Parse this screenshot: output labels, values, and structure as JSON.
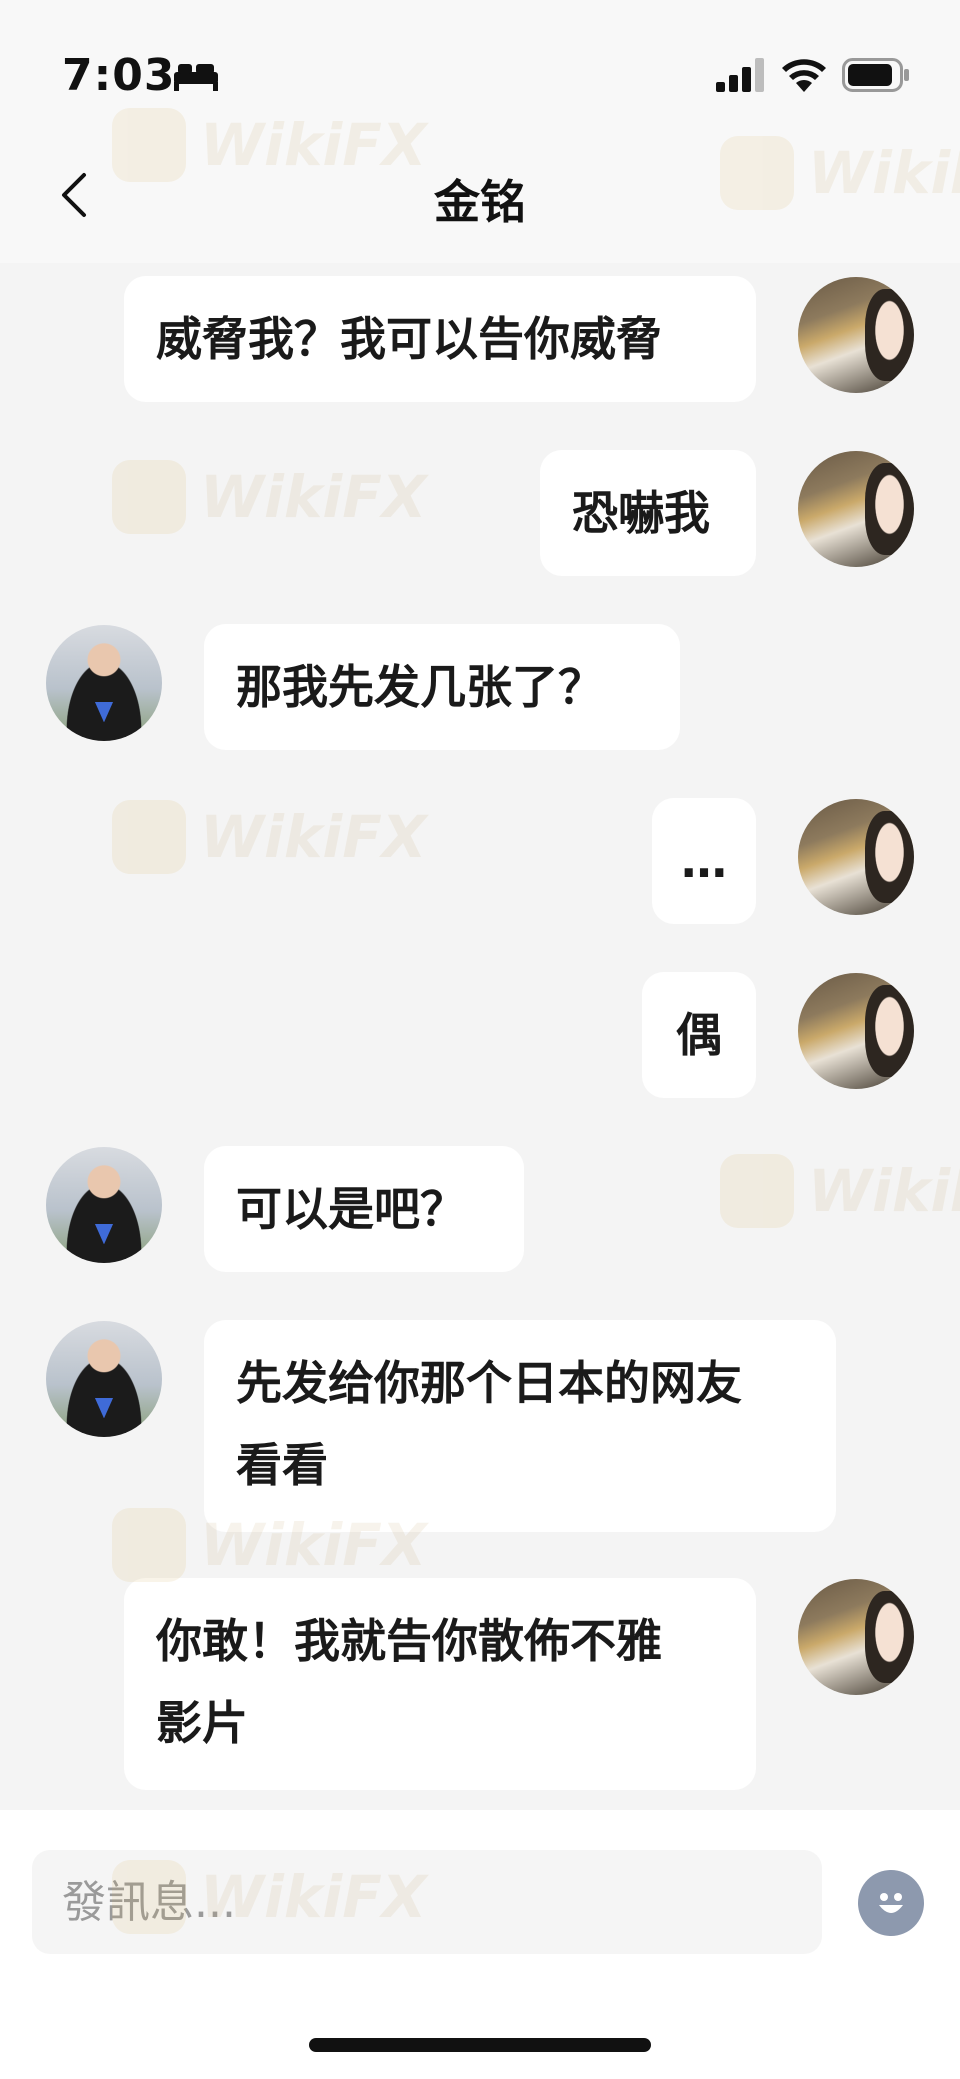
{
  "status_bar": {
    "time": "7:03"
  },
  "header": {
    "title": "金铭"
  },
  "messages": [
    {
      "side": "right",
      "text": "威脅我？我可以告你威脅"
    },
    {
      "side": "right",
      "text": "恐嚇我"
    },
    {
      "side": "left",
      "text": "那我先发几张了？"
    },
    {
      "side": "right",
      "text": "…"
    },
    {
      "side": "right",
      "text": "偶"
    },
    {
      "side": "left",
      "text": "可以是吧？"
    },
    {
      "side": "left",
      "text": "先发给你那个日本的网友\n看看"
    },
    {
      "side": "right",
      "text": "你敢！我就告你散佈不雅\n影片"
    }
  ],
  "composer": {
    "placeholder": "發訊息..."
  },
  "watermark": {
    "text": "WikiFX"
  },
  "colors": {
    "background": "#f4f4f4",
    "bubble": "#ffffff",
    "emoji_button": "#8d99ae"
  }
}
